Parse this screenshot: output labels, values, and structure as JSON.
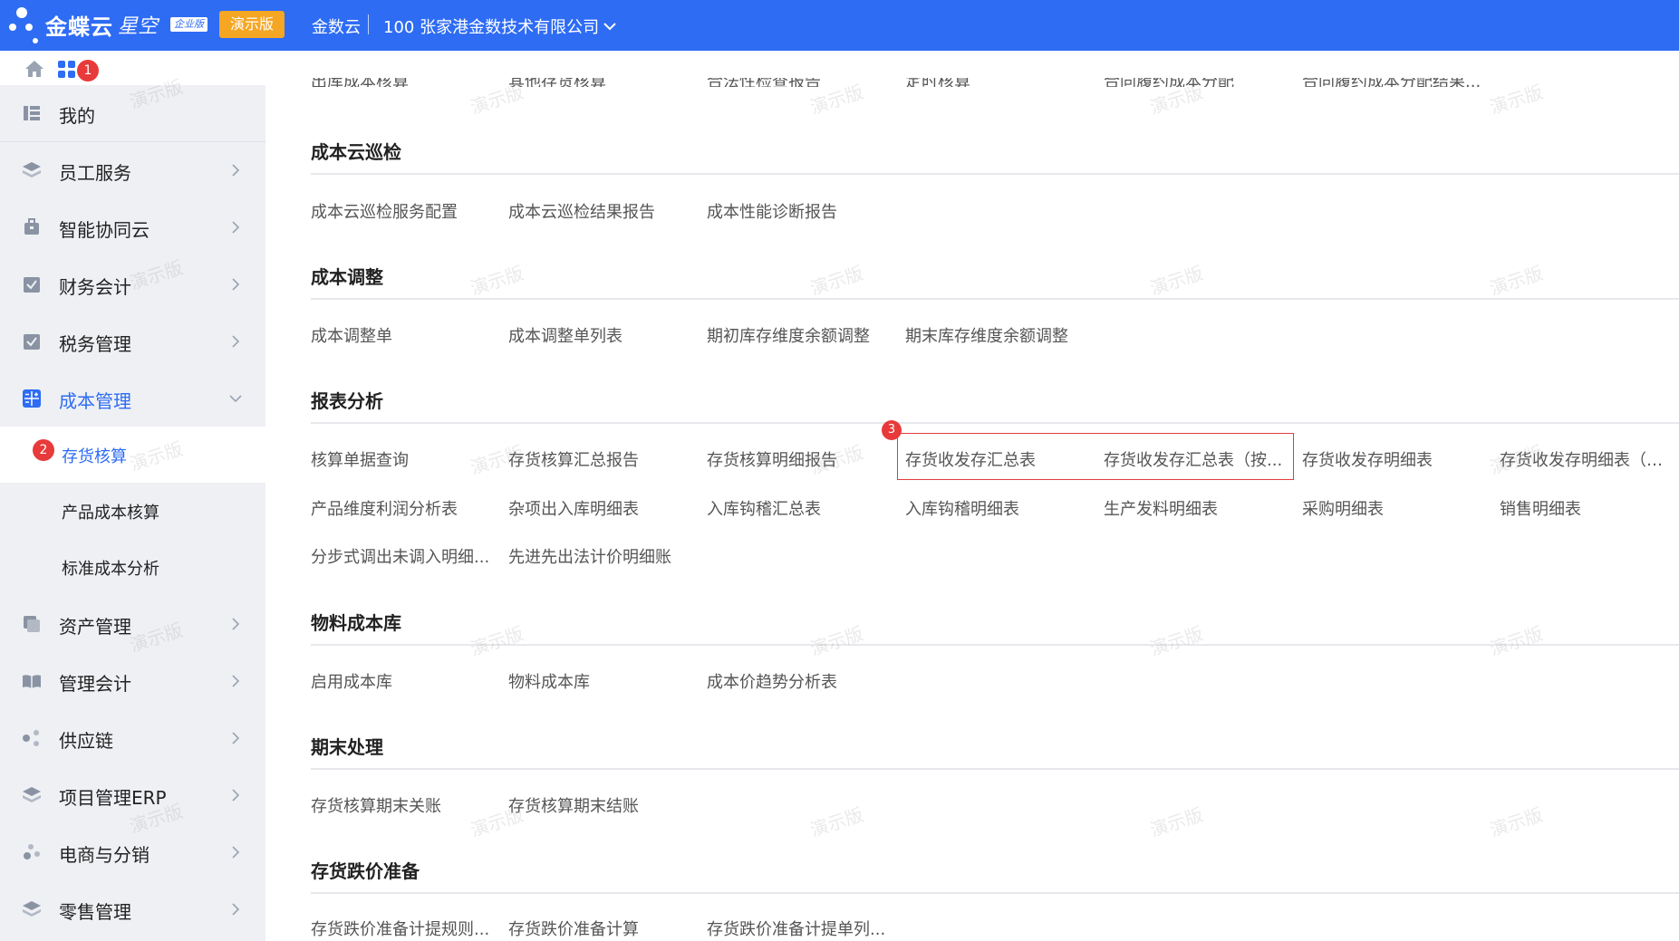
{
  "topbar": {
    "logo_text": "金蝶云",
    "logo_sub": "星空",
    "edition": "企业版",
    "demo_badge": "演示版",
    "brand": "金数云",
    "company": "100 张家港金数技术有限公司",
    "color": "#2e6cf4"
  },
  "markers": {
    "m1": "1",
    "m2": "2",
    "m3": "3"
  },
  "sidebar": {
    "items": [
      {
        "label": "我的",
        "icon": "my-icon"
      },
      {
        "label": "员工服务",
        "icon": "layers-icon"
      },
      {
        "label": "智能协同云",
        "icon": "briefcase-icon"
      },
      {
        "label": "财务会计",
        "icon": "check-icon"
      },
      {
        "label": "税务管理",
        "icon": "check-icon"
      },
      {
        "label": "成本管理",
        "icon": "calculator-icon"
      },
      {
        "label": "资产管理",
        "icon": "asset-icon"
      },
      {
        "label": "管理会计",
        "icon": "book-icon"
      },
      {
        "label": "供应链",
        "icon": "nodes-icon"
      },
      {
        "label": "项目管理ERP",
        "icon": "layers-icon"
      },
      {
        "label": "电商与分销",
        "icon": "nodes-icon"
      },
      {
        "label": "零售管理",
        "icon": "layers-icon"
      }
    ],
    "sub_items": [
      {
        "label": "存货核算"
      },
      {
        "label": "产品成本核算"
      },
      {
        "label": "标准成本分析"
      }
    ]
  },
  "main": {
    "cut_row": [
      "出库成本核算",
      "其他存货核算",
      "合法性检查报告",
      "定时核算",
      "合同履约成本分配",
      "合同履约成本分配结果..."
    ],
    "sections": [
      {
        "title": "成本云巡检",
        "links": [
          "成本云巡检服务配置",
          "成本云巡检结果报告",
          "成本性能诊断报告"
        ]
      },
      {
        "title": "成本调整",
        "links": [
          "成本调整单",
          "成本调整单列表",
          "期初库存维度余额调整",
          "期末库存维度余额调整"
        ]
      },
      {
        "title": "报表分析",
        "links": [
          "核算单据查询",
          "存货核算汇总报告",
          "存货核算明细报告",
          "存货收发存汇总表",
          "存货收发存汇总表（按...",
          "存货收发存明细表",
          "存货收发存明细表（跨...",
          "产品维度利润分析表",
          "杂项出入库明细表",
          "入库钩稽汇总表",
          "入库钩稽明细表",
          "生产发料明细表",
          "采购明细表",
          "销售明细表",
          "分步式调出未调入明细...",
          "先进先出法计价明细账"
        ]
      },
      {
        "title": "物料成本库",
        "links": [
          "启用成本库",
          "物料成本库",
          "成本价趋势分析表"
        ]
      },
      {
        "title": "期末处理",
        "links": [
          "存货核算期末关账",
          "存货核算期末结账"
        ]
      },
      {
        "title": "存货跌价准备",
        "links": [
          "存货跌价准备计提规则...",
          "存货跌价准备计算",
          "存货跌价准备计提单列..."
        ]
      }
    ],
    "watermark": "演示版"
  }
}
